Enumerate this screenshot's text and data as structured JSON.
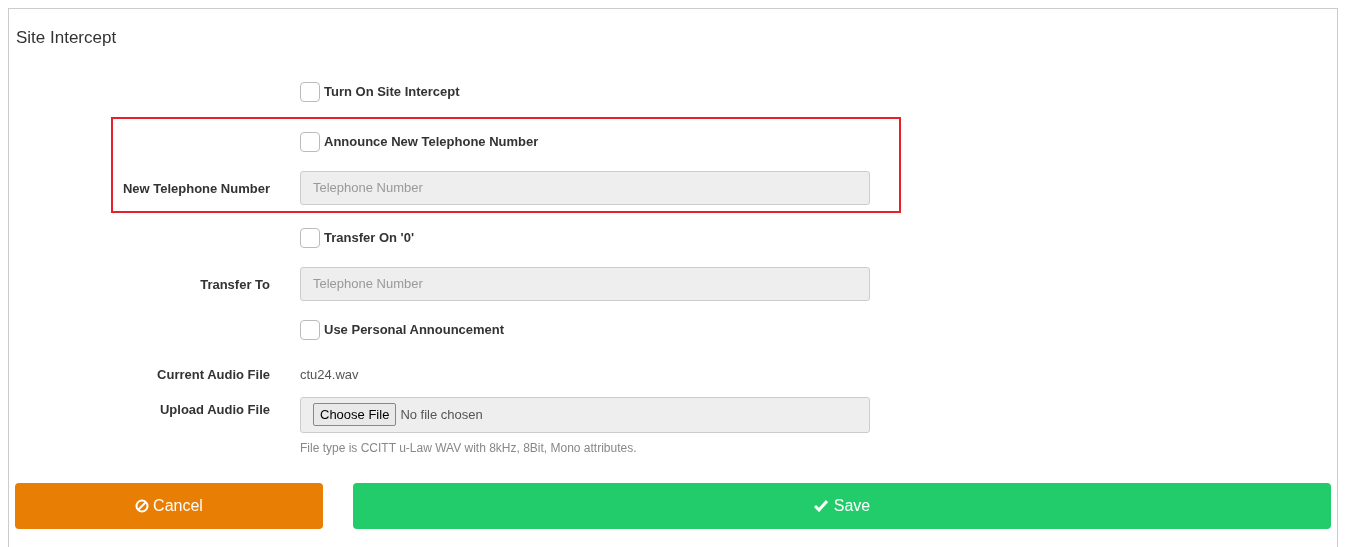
{
  "panel": {
    "title": "Site Intercept"
  },
  "sections": [
    {
      "highlighted": false,
      "rows": [
        {
          "kind": "checkbox",
          "label": "Turn On Site Intercept",
          "checked": false
        }
      ]
    },
    {
      "highlighted": true,
      "rows": [
        {
          "kind": "checkbox",
          "label": "Announce New Telephone Number",
          "checked": false
        },
        {
          "kind": "input",
          "label": "New Telephone Number",
          "placeholder": "Telephone Number",
          "disabled": true
        }
      ]
    },
    {
      "highlighted": false,
      "rows": [
        {
          "kind": "checkbox",
          "label": "Transfer On '0'",
          "checked": false
        },
        {
          "kind": "input",
          "label": "Transfer To",
          "placeholder": "Telephone Number",
          "disabled": true
        },
        {
          "kind": "checkbox",
          "label": "Use Personal Announcement",
          "checked": false
        },
        {
          "kind": "text",
          "label": "Current Audio File",
          "value": "ctu24.wav"
        },
        {
          "kind": "file",
          "label": "Upload Audio File",
          "button": "Choose File",
          "value": "No file chosen",
          "help": "File type is CCITT u-Law WAV with 8kHz, 8Bit, Mono attributes."
        }
      ]
    }
  ],
  "buttons": [
    {
      "kind": "cancel",
      "label": "Cancel"
    },
    {
      "kind": "save",
      "label": "Save"
    }
  ]
}
